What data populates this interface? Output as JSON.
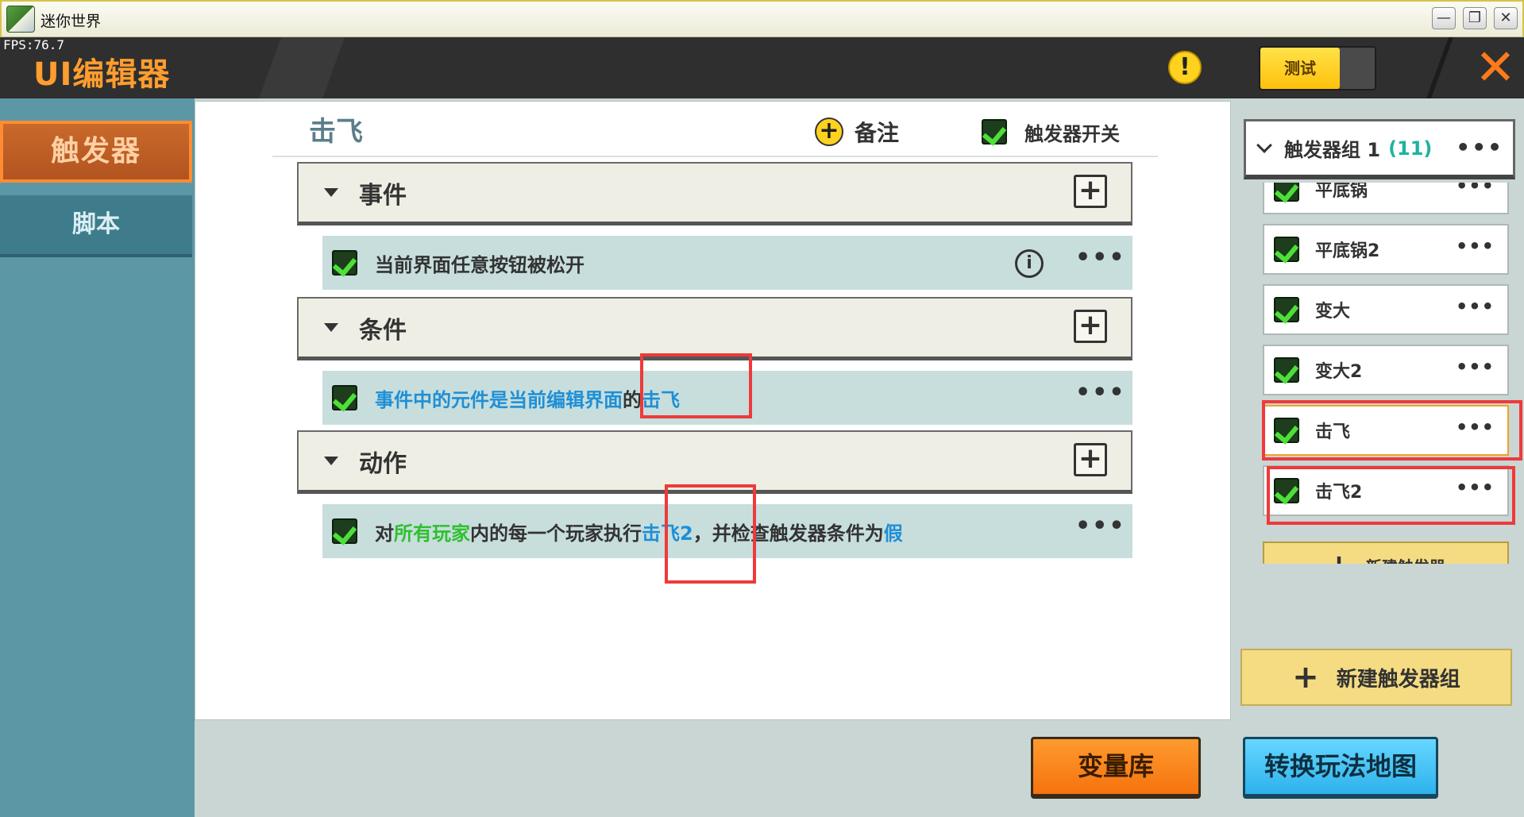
{
  "window": {
    "title": "迷你世界",
    "minimize": "—",
    "restore": "❐",
    "close": "✕"
  },
  "header": {
    "fps": "FPS:76.7",
    "title": "UI编辑器",
    "warning_icon": "!",
    "test_label": "测试",
    "close_icon": "✕"
  },
  "nav": {
    "trigger_tab": "触发器",
    "script_tab": "脚本"
  },
  "panel": {
    "title": "击飞",
    "note_label": "备注",
    "trigger_switch_label": "触发器开关",
    "sections": [
      {
        "label": "事件",
        "rule": [
          {
            "text": "当前界面任意按钮被松开",
            "style": "plain"
          }
        ],
        "has_info": true
      },
      {
        "label": "条件",
        "rule": [
          {
            "text": "事件中的元件是当前编辑界面",
            "style": "blue"
          },
          {
            "text": "的",
            "style": "plain"
          },
          {
            "text": "击飞",
            "style": "blue"
          }
        ],
        "has_info": false
      },
      {
        "label": "动作",
        "rule": [
          {
            "text": "对",
            "style": "plain"
          },
          {
            "text": "所有玩家",
            "style": "green"
          },
          {
            "text": "内的每一个玩家执行",
            "style": "plain"
          },
          {
            "text": "击飞2",
            "style": "blue"
          },
          {
            "text": "，并检查触发器条件为",
            "style": "plain"
          },
          {
            "text": "假",
            "style": "blue"
          }
        ],
        "has_info": false
      }
    ],
    "info_icon": "i",
    "more": "•••",
    "add": "+"
  },
  "right": {
    "group_name": "触发器组 1",
    "group_count": "(11)",
    "group_more": "•••",
    "triggers": [
      "平底锅",
      "平底锅2",
      "变大",
      "变大2",
      "击飞",
      "击飞2"
    ],
    "item_more": "•••",
    "new_trigger": "新建触发器",
    "new_group": "新建触发器组",
    "plus": "+"
  },
  "bottom": {
    "variables": "变量库",
    "convert_map": "转换玩法地图"
  },
  "colors": {
    "accent_orange": "#ff8c32",
    "highlight_red": "#ee3a3a",
    "text_blue": "#1f8fd6",
    "text_green": "#2fc02f"
  }
}
